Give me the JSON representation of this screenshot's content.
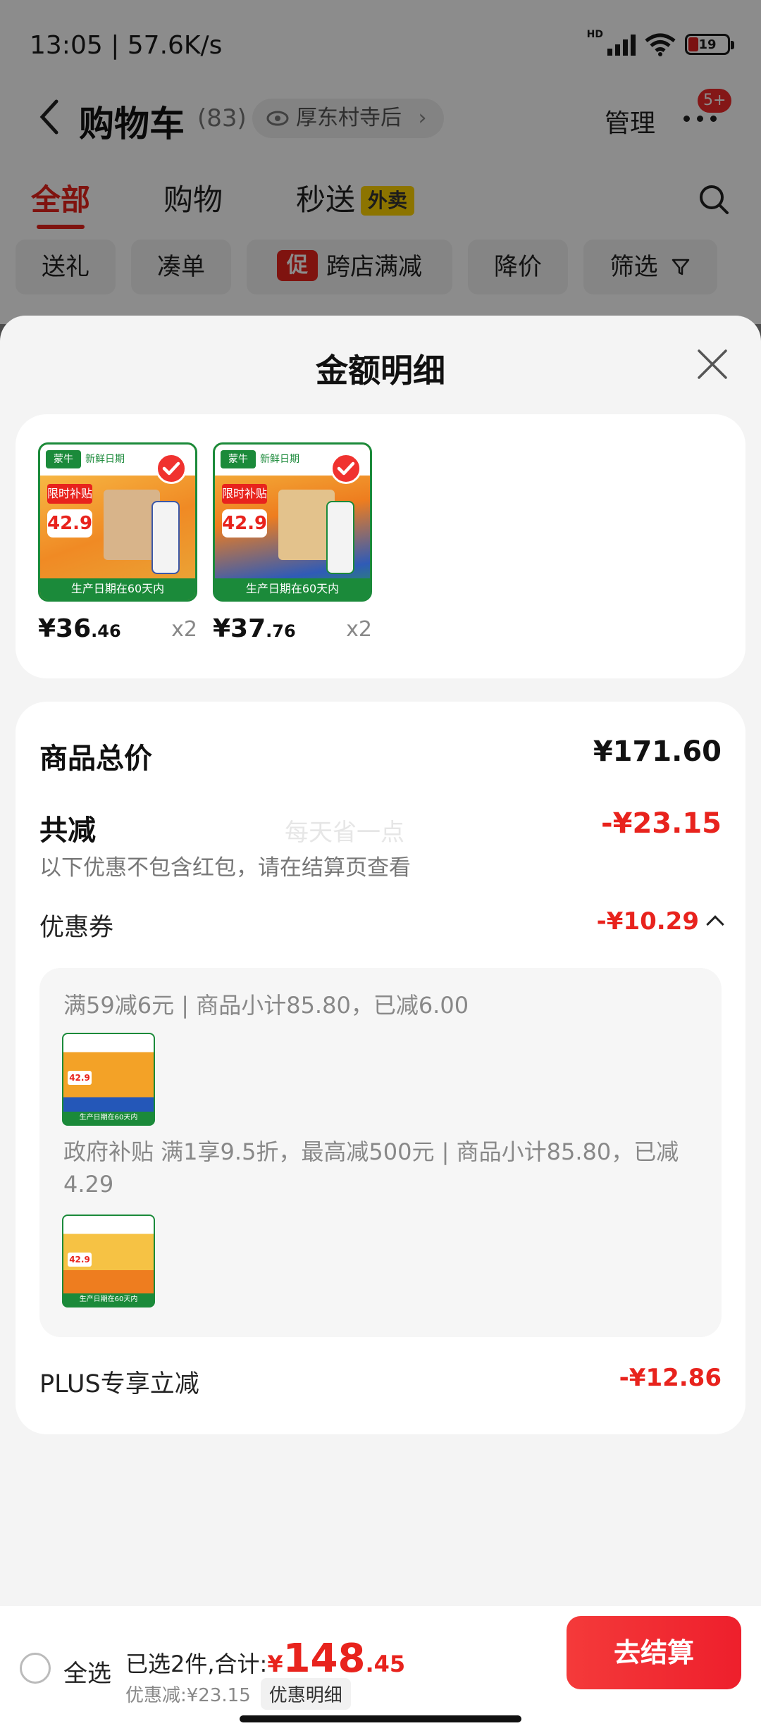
{
  "status": {
    "time": "13:05 | 57.6K/s",
    "battery": "19",
    "network": "HD"
  },
  "nav": {
    "title": "购物车",
    "count": "(83)",
    "location": "厚东村寺后",
    "manage": "管理",
    "badge": "5+"
  },
  "tabs": [
    {
      "label": "全部"
    },
    {
      "label": "购物"
    },
    {
      "label": "秒送",
      "tag": "外卖"
    }
  ],
  "chips": [
    {
      "label": "送礼"
    },
    {
      "label": "凑单"
    },
    {
      "tag": "促",
      "label": "跨店满减"
    },
    {
      "label": "降价"
    },
    {
      "label": "筛选"
    }
  ],
  "sheet": {
    "title": "金额明细",
    "products": [
      {
        "price_int": "¥36",
        "price_dec": ".46",
        "qty": "x2",
        "brand": "蒙牛",
        "fresh": "新鲜日期",
        "limit": "限时补贴",
        "tag_price": "42.9",
        "footer": "生产日期在60天内"
      },
      {
        "price_int": "¥37",
        "price_dec": ".76",
        "qty": "x2",
        "brand": "蒙牛",
        "fresh": "新鲜日期",
        "limit": "限时补贴",
        "tag_price": "42.9",
        "footer": "生产日期在60天内"
      }
    ],
    "total_label": "商品总价",
    "total_value": "¥171.60",
    "reduce_label": "共减",
    "reduce_value": "-¥23.15",
    "reduce_note": "以下优惠不包含红包，请在结算页查看",
    "watermark": "每天省一点",
    "coupon_label": "优惠券",
    "coupon_value": "-¥10.29",
    "coupon_line1": "满59减6元 | 商品小计85.80，已减6.00",
    "coupon_line2": "政府补贴 满1享9.5折，最高减500元 | 商品小计85.80，已减4.29",
    "thumb_footer": "生产日期在60天内",
    "thumb_price": "42.9",
    "plus_label": "PLUS专享立减",
    "plus_value": "-¥12.86"
  },
  "bottom": {
    "select_all": "全选",
    "selected": "已选2件,合计:",
    "currency": "¥",
    "total_int": "148",
    "total_dec": ".45",
    "discount": "优惠减:¥23.15",
    "discount_btn": "优惠明细",
    "checkout": "去结算"
  },
  "colors": {
    "accent": "#e8231d",
    "brand_green": "#1b8a3a",
    "takeout_yellow": "#ffd400"
  }
}
